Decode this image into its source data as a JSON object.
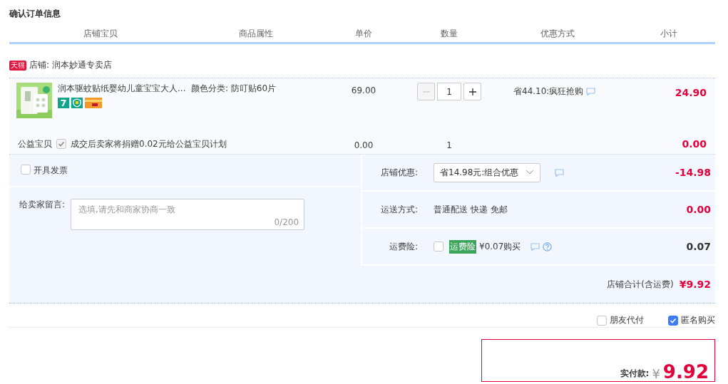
{
  "title": "确认订单信息",
  "columns": [
    "店铺宝贝",
    "商品属性",
    "单价",
    "数量",
    "优惠方式",
    "小计"
  ],
  "store": {
    "badge": "天猫",
    "label": "店铺: 润本妙通专卖店"
  },
  "item": {
    "name": "润本驱蚊贴纸婴幼儿童宝宝大人...",
    "attribute": "颜色分类: 防叮贴60片",
    "service_badges": [
      {
        "kind": "seven",
        "text": "7"
      },
      {
        "kind": "shield"
      },
      {
        "kind": "card"
      }
    ],
    "unit_price": "69.00",
    "quantity": "1",
    "decrease_disabled": true,
    "discount": "省44.10:疯狂抢购",
    "subtotal": "24.90"
  },
  "charity": {
    "label": "公益宝贝",
    "checked": true,
    "disabled": true,
    "text": "成交后卖家将捐赠0.02元给公益宝贝计划",
    "unit_price": "0.00",
    "quantity": "1",
    "subtotal": "0.00"
  },
  "invoice": {
    "label": "开具发票",
    "checked": false
  },
  "message": {
    "label": "给卖家留言:",
    "placeholder": "选填,请先和商家协商一致",
    "counter": "0/200"
  },
  "store_discount": {
    "label": "店铺优惠:",
    "value": "省14.98元:组合优惠",
    "amount": "-14.98",
    "emphasis": true
  },
  "shipping": {
    "label": "运送方式:",
    "value": "普通配送 快递 免邮",
    "amount": "0.00",
    "emphasis": true
  },
  "insurance": {
    "label": "运费险:",
    "checked": false,
    "tag": "运费险",
    "price": "¥0.07购买",
    "amount": "0.07",
    "emphasis": false
  },
  "store_total": {
    "label": "店铺合计(含运费)",
    "amount": "¥9.92"
  },
  "options": [
    {
      "label": "朋友代付",
      "checked": false
    },
    {
      "label": "匿名购买",
      "checked": true
    }
  ],
  "payment": {
    "label": "实付款:",
    "currency": "¥",
    "amount": "9.92"
  }
}
